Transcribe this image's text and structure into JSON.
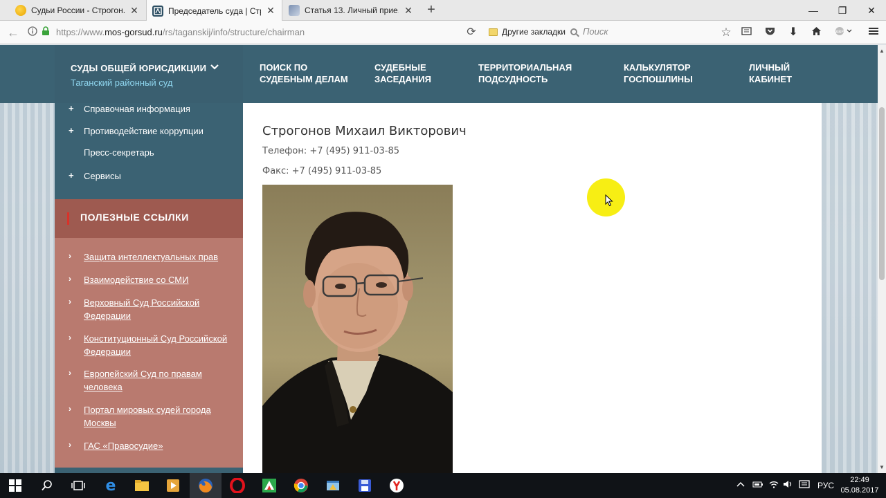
{
  "browser": {
    "tabs": [
      {
        "title": "Судьи России - Строгон...",
        "active": false
      },
      {
        "title": "Председатель суда | Стру...",
        "active": true
      },
      {
        "title": "Статья 13. Личный прие...",
        "active": false
      }
    ],
    "new_tab_glyph": "+",
    "window_controls": {
      "minimize": "—",
      "maximize": "❐",
      "close": "✕"
    },
    "url_prefix": "https://www.",
    "url_domain": "mos-gorsud.ru",
    "url_path": "/rs/taganskij/info/structure/chairman",
    "bookmarks_label": "Другие закладки",
    "search_placeholder": "Поиск"
  },
  "site": {
    "court_selector": {
      "title": "СУДЫ ОБЩЕЙ ЮРИСДИКЦИИ",
      "subtitle": "Таганский районный суд"
    },
    "menu": [
      {
        "label": "ПОИСК ПО\nСУДЕБНЫМ ДЕЛАМ"
      },
      {
        "label": "СУДЕБНЫЕ\nЗАСЕДАНИЯ"
      },
      {
        "label": "ТЕРРИТОРИАЛЬНАЯ\nПОДСУДНОСТЬ"
      },
      {
        "label": "КАЛЬКУЛЯТОР\nГОСПОШЛИНЫ"
      },
      {
        "label": "ЛИЧНЫЙ\nКАБИНЕТ"
      }
    ],
    "sidebar_items": [
      {
        "label": "Справочная информация",
        "expandable": true
      },
      {
        "label": "Противодействие коррупции",
        "expandable": true
      },
      {
        "label": "Пресс-секретарь",
        "expandable": false
      },
      {
        "label": "Сервисы",
        "expandable": true
      }
    ],
    "useful_links_title": "ПОЛЕЗНЫЕ ССЫЛКИ",
    "useful_links": [
      {
        "label": "Защита интеллектуальных прав"
      },
      {
        "label": "Взаимодействие со СМИ"
      },
      {
        "label": "Верховный Суд Российской Федерации"
      },
      {
        "label": "Конституционный Суд Российской Федерации"
      },
      {
        "label": "Европейский Суд по правам человека"
      },
      {
        "label": "Портал мировых судей города Москвы"
      },
      {
        "label": "ГАС «Правосудие»"
      }
    ],
    "person": {
      "name": "Строгонов Михаил Викторович",
      "phone": "Телефон: +7 (495) 911-03-85",
      "fax": "Факс: +7 (495) 911-03-85"
    }
  },
  "taskbar": {
    "language": "РУС",
    "time": "22:49",
    "date": "05.08.2017"
  },
  "colors": {
    "nav_blue": "#3b6273",
    "court_sub": "#8fd6ef",
    "links_panel": "#b97a6f",
    "links_header": "#9e5a50",
    "accent_red": "#d9322a",
    "cursor_highlight": "#f7ee14"
  }
}
